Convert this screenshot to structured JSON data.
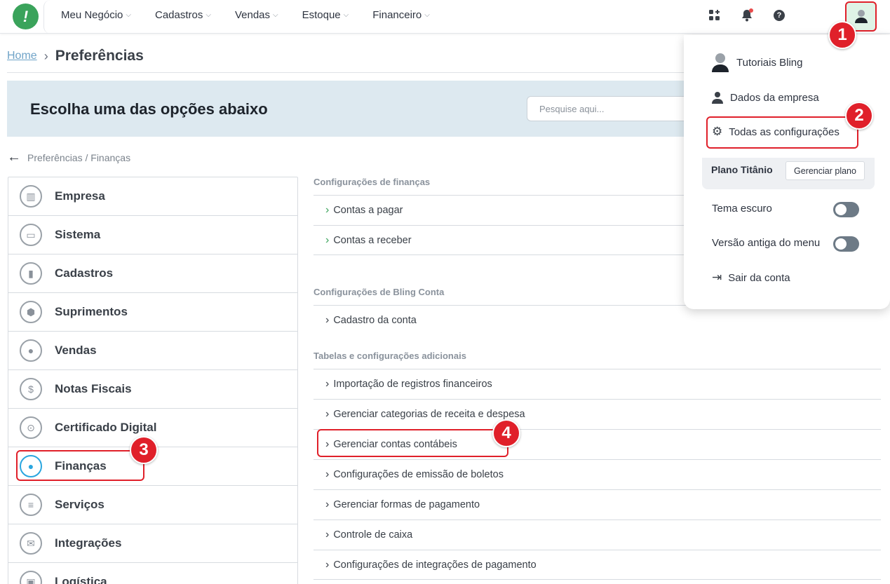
{
  "nav": {
    "items": [
      "Meu Negócio",
      "Cadastros",
      "Vendas",
      "Estoque",
      "Financeiro"
    ]
  },
  "header_icons": [
    "apps-icon",
    "bell-icon",
    "help-icon",
    "user-icon"
  ],
  "breadcrumb": {
    "home": "Home",
    "current": "Preferências"
  },
  "banner": {
    "title": "Escolha uma das opções abaixo",
    "search_placeholder": "Pesquise aqui..."
  },
  "path": "Preferências / Finanças",
  "left_menu": [
    {
      "label": "Empresa",
      "icon": "building-icon"
    },
    {
      "label": "Sistema",
      "icon": "monitor-icon"
    },
    {
      "label": "Cadastros",
      "icon": "book-icon"
    },
    {
      "label": "Suprimentos",
      "icon": "box-icon"
    },
    {
      "label": "Vendas",
      "icon": "users-icon"
    },
    {
      "label": "Notas Fiscais",
      "icon": "invoice-icon"
    },
    {
      "label": "Certificado Digital",
      "icon": "lock-icon"
    },
    {
      "label": "Finanças",
      "icon": "piggy-bank-icon",
      "active": true
    },
    {
      "label": "Serviços",
      "icon": "document-icon"
    },
    {
      "label": "Integrações",
      "icon": "envelope-icon"
    },
    {
      "label": "Logística",
      "icon": "truck-icon"
    }
  ],
  "sections": {
    "financas": {
      "title": "Configurações de finanças",
      "items": [
        "Contas a pagar",
        "Contas a receber"
      ]
    },
    "bling_conta": {
      "title": "Configurações de Bling Conta",
      "items": [
        "Cadastro da conta"
      ]
    },
    "tabelas": {
      "title": "Tabelas e configurações adicionais",
      "items": [
        "Importação de registros financeiros",
        "Gerenciar categorias de receita e despesa",
        "Gerenciar contas contábeis",
        "Configurações de emissão de boletos",
        "Gerenciar formas de pagamento",
        "Controle de caixa",
        "Configurações de integrações de pagamento"
      ]
    }
  },
  "dropdown": {
    "user": "Tutoriais Bling",
    "company": "Dados da empresa",
    "settings": "Todas as configurações",
    "plan_label": "Plano Titânio",
    "plan_button": "Gerenciar plano",
    "dark_theme": "Tema escuro",
    "old_menu": "Versão antiga do menu",
    "logout": "Sair da conta"
  },
  "markers": [
    "1",
    "2",
    "3",
    "4"
  ],
  "colors": {
    "brand_green": "#3aa35b",
    "highlight_red": "#e0202a",
    "active_blue": "#2aa6df",
    "banner_bg": "#dde9f0"
  }
}
